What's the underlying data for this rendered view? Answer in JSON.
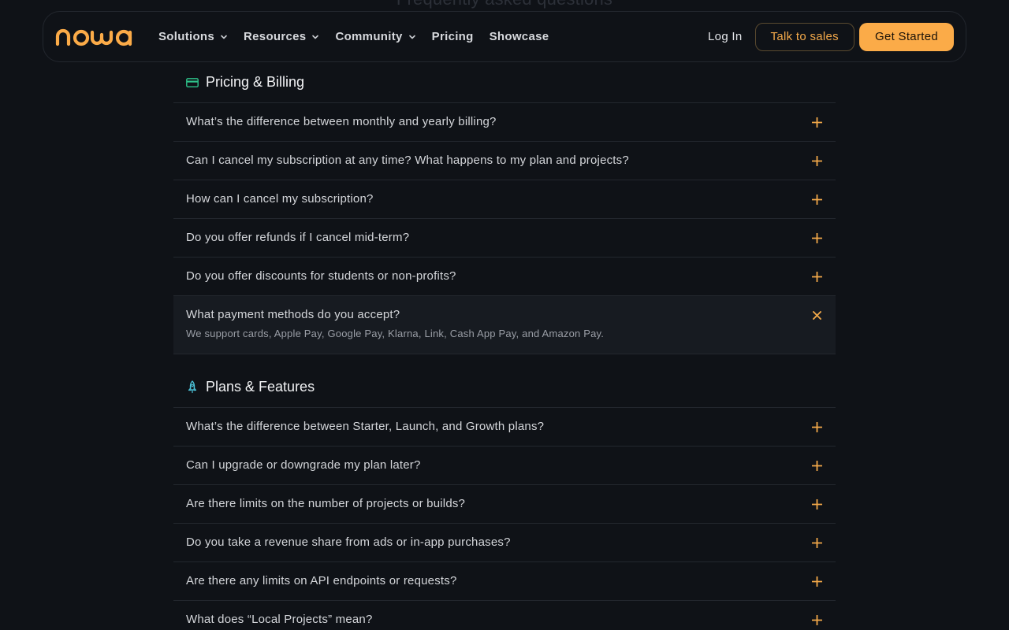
{
  "page": {
    "faded_heading": "Frequently asked questions"
  },
  "nav": {
    "logo": "nowa",
    "links": [
      {
        "label": "Solutions",
        "dropdown": true
      },
      {
        "label": "Resources",
        "dropdown": true
      },
      {
        "label": "Community",
        "dropdown": true
      },
      {
        "label": "Pricing",
        "dropdown": false
      },
      {
        "label": "Showcase",
        "dropdown": false
      }
    ],
    "login": "Log In",
    "talk_to_sales": "Talk to sales",
    "get_started": "Get Started"
  },
  "colors": {
    "accent": "#fbab48",
    "background": "#0f1217",
    "billing_icon": "#2ec28a",
    "plans_icon": "#4cc3d9"
  },
  "sections": [
    {
      "title": "Pricing & Billing",
      "icon": "credit-card-icon",
      "items": [
        {
          "question": "What’s the difference between monthly and yearly billing?",
          "open": false
        },
        {
          "question": "Can I cancel my subscription at any time? What happens to my plan and projects?",
          "open": false
        },
        {
          "question": "How can I cancel my subscription?",
          "open": false
        },
        {
          "question": "Do you offer refunds if I cancel mid-term?",
          "open": false
        },
        {
          "question": "Do you offer discounts for students or non-profits?",
          "open": false
        },
        {
          "question": "What payment methods do you accept?",
          "open": true,
          "answer": "We support cards, Apple Pay, Google Pay, Klarna, Link, Cash App Pay, and Amazon Pay."
        }
      ]
    },
    {
      "title": "Plans & Features",
      "icon": "rocket-icon",
      "items": [
        {
          "question": "What’s the difference between Starter, Launch, and Growth plans?",
          "open": false
        },
        {
          "question": "Can I upgrade or downgrade my plan later?",
          "open": false
        },
        {
          "question": "Are there limits on the number of projects or builds?",
          "open": false
        },
        {
          "question": "Do you take a revenue share from ads or in-app purchases?",
          "open": false
        },
        {
          "question": "Are there any limits on API endpoints or requests?",
          "open": false
        },
        {
          "question": "What does “Local Projects” mean?",
          "open": false
        }
      ]
    }
  ]
}
